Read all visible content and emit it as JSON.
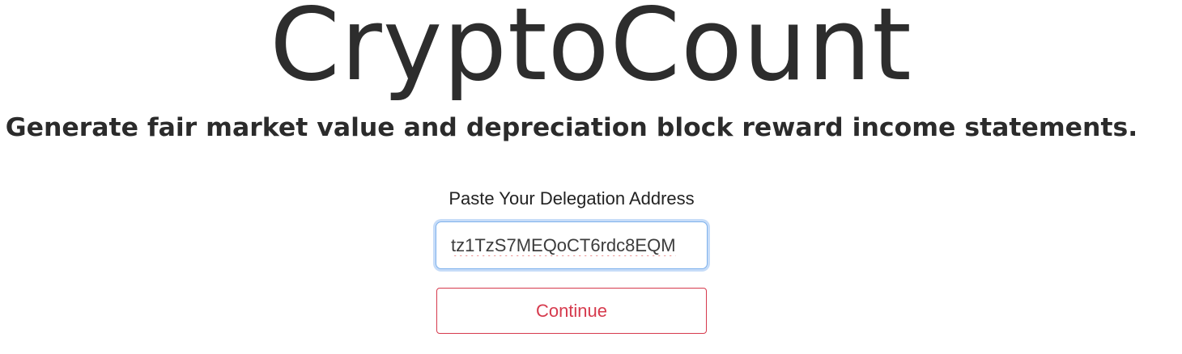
{
  "brand": {
    "title": "CryptoCount"
  },
  "tagline": "Generate fair market value and depreciation block reward income statements.",
  "form": {
    "label": "Paste Your Delegation Address",
    "address_value": "tz1TzS7MEQoCT6rdc8EQM",
    "continue_label": "Continue"
  },
  "colors": {
    "text": "#2b2b2b",
    "accent_danger": "#d63a4d",
    "focus_ring": "#7fb2ec",
    "spellcheck_underline": "#e05252"
  }
}
